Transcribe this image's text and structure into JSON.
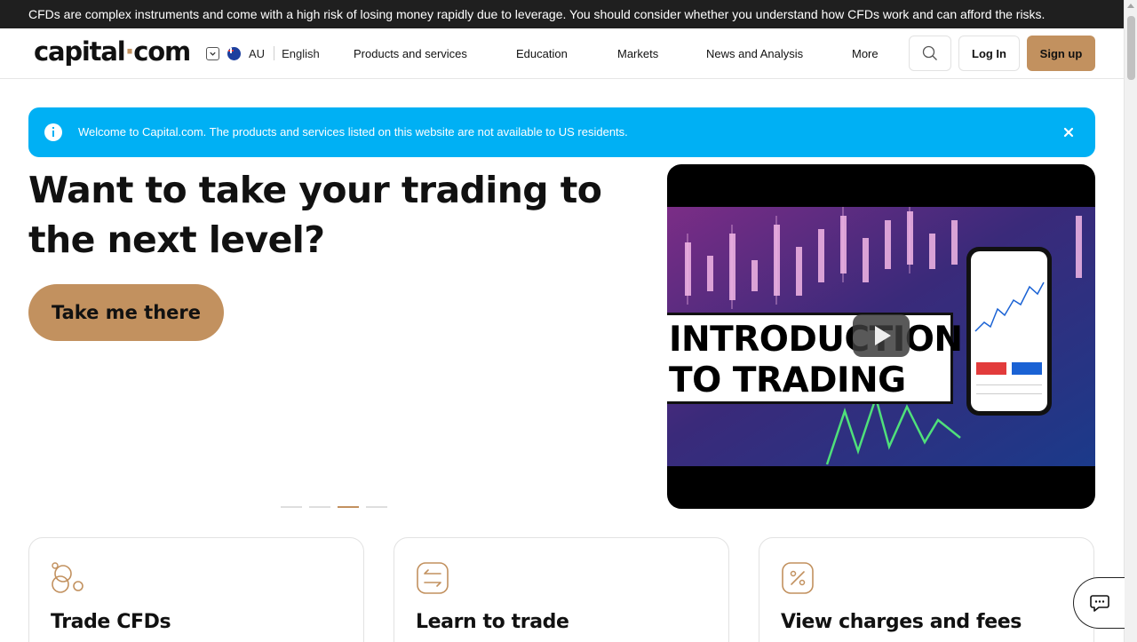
{
  "risk_warning": "CFDs are complex instruments and come with a high risk of losing money rapidly due to leverage. You should consider whether you understand how CFDs work and can afford the risks.",
  "header": {
    "logo_main": "capital",
    "logo_dot": "·",
    "logo_tld": "com",
    "region_code": "AU",
    "language": "English",
    "nav": [
      "Products and services",
      "Education",
      "Markets",
      "News and Analysis",
      "More"
    ],
    "login_label": "Log In",
    "signup_label": "Sign up"
  },
  "notice": {
    "text": "Welcome to Capital.com. The products and services listed on this website are not available to US residents."
  },
  "hero": {
    "title": "Want to take your trading to the next level?",
    "cta_label": "Take me there",
    "slide_count": 4,
    "active_slide": 3,
    "video_caption_line1": "INTRODUCTION",
    "video_caption_line2": "TO TRADING"
  },
  "cards": [
    {
      "title": "Trade CFDs",
      "icon": "coins-icon"
    },
    {
      "title": "Learn to trade",
      "icon": "exchange-arrows-icon"
    },
    {
      "title": "View charges and fees",
      "icon": "percent-icon"
    }
  ],
  "colors": {
    "accent": "#c2915f",
    "notice_bg": "#00b0f4",
    "risk_bar_bg": "#1f1f1f"
  }
}
